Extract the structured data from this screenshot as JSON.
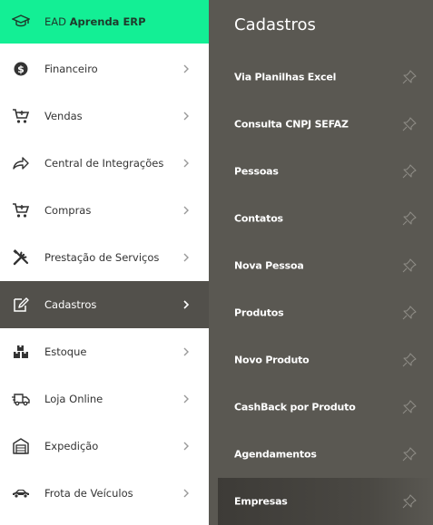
{
  "sidebar": {
    "top": {
      "prefix": "EAD",
      "name": "Aprenda ERP",
      "icon": "graduation-cap-icon"
    },
    "items": [
      {
        "label": "Financeiro",
        "icon": "dollar-coin-icon"
      },
      {
        "label": "Vendas",
        "icon": "cart-icon"
      },
      {
        "label": "Central de Integrações",
        "icon": "share-arrow-icon"
      },
      {
        "label": "Compras",
        "icon": "cart-icon"
      },
      {
        "label": "Prestação de Serviços",
        "icon": "tools-icon"
      },
      {
        "label": "Cadastros",
        "icon": "edit-note-icon",
        "active": true
      },
      {
        "label": "Estoque",
        "icon": "boxes-icon"
      },
      {
        "label": "Loja Online",
        "icon": "delivery-truck-icon"
      },
      {
        "label": "Expedição",
        "icon": "warehouse-icon"
      },
      {
        "label": "Frota de Veículos",
        "icon": "car-icon"
      }
    ]
  },
  "submenu": {
    "title": "Cadastros",
    "items": [
      {
        "label": "Via Planilhas Excel"
      },
      {
        "label": "Consulta CNPJ SEFAZ"
      },
      {
        "label": "Pessoas"
      },
      {
        "label": "Contatos"
      },
      {
        "label": "Nova Pessoa"
      },
      {
        "label": "Produtos"
      },
      {
        "label": "Novo Produto"
      },
      {
        "label": "CashBack por Produto"
      },
      {
        "label": "Agendamentos"
      },
      {
        "label": "Empresas",
        "highlighted": true
      }
    ]
  },
  "colors": {
    "accent": "#13ef95",
    "submenu_bg": "#5a5852",
    "active_bg": "#52504b"
  }
}
